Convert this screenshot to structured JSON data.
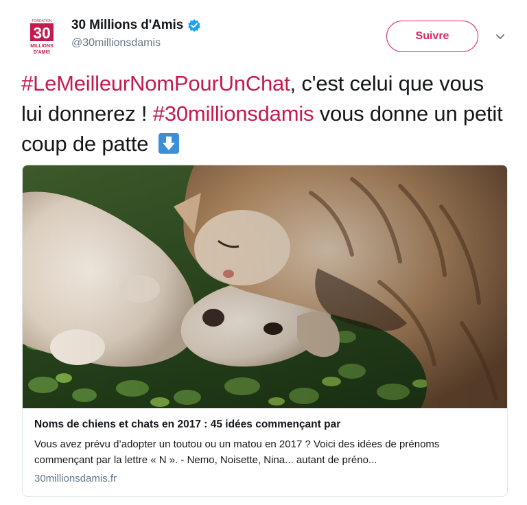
{
  "author": {
    "name": "30 Millions d'Amis",
    "handle": "@30millionsdamis",
    "avatar_text": [
      "FONDATION",
      "30",
      "MILLIONS",
      "D'AMIS"
    ],
    "verified": true
  },
  "follow_button": {
    "label": "Suivre"
  },
  "tweet": {
    "hashtag1": "#LeMeilleurNomPourUnChat",
    "text1": ", c'est celui que vous lui donnerez ! ",
    "hashtag2": "#30millionsdamis",
    "text2": " vous donne un petit coup de patte",
    "emoji": "down-arrow-emoji"
  },
  "card": {
    "title": "Noms de chiens et chats en 2017 : 45 idées commençant par",
    "description": "Vous avez prévu d’adopter un toutou ou un matou en 2017 ? Voici des idées de prénoms commençant par la lettre « N ». - Nemo, Noisette, Nina... autant de préno...",
    "domain": "30millionsdamis.fr",
    "image": "cat-and-dog-photo"
  },
  "colors": {
    "hashtag": "#c41b4f",
    "follow_accent": "#e0245e",
    "verified": "#1da1f2",
    "secondary_text": "#657786"
  },
  "icons": [
    "verified-badge-icon",
    "chevron-down-icon",
    "down-arrow-emoji"
  ]
}
